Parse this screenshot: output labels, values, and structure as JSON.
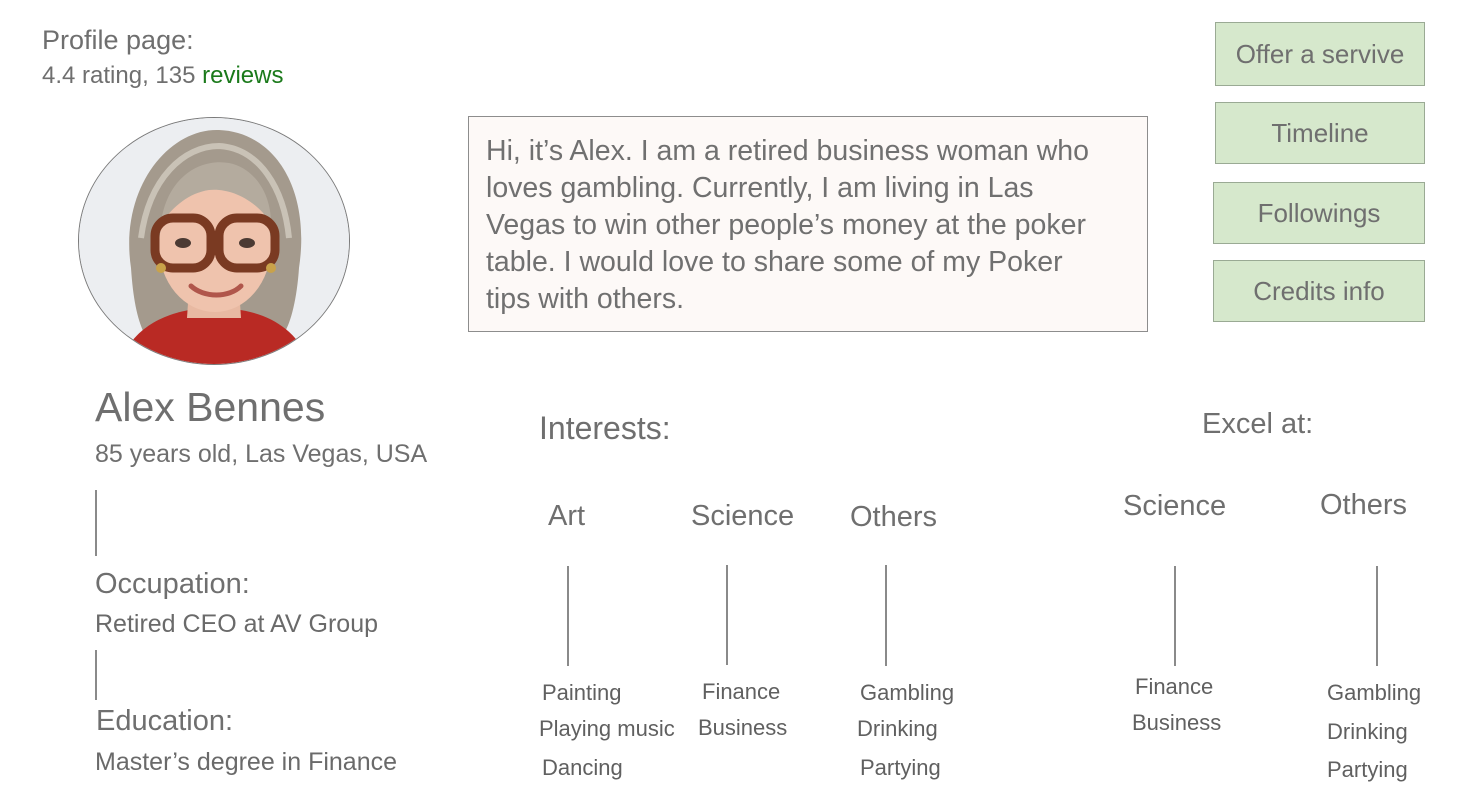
{
  "header": {
    "title": "Profile page:",
    "rating_text": "4.4 rating, 135 ",
    "reviews_link": "reviews"
  },
  "bio": {
    "line1": "Hi, it’s Alex. I am a retired business woman who",
    "line2": "loves gambling. Currently, I am living in Las",
    "line3": "Vegas to win other people’s money at the poker",
    "line4": "table. I would love to share some of my Poker",
    "line5": "tips with others."
  },
  "actions": {
    "offer": "Offer a servive",
    "timeline": "Timeline",
    "followings": "Followings",
    "credits": "Credits info"
  },
  "profile": {
    "name": "Alex Bennes",
    "meta": "85 years old, Las Vegas, USA",
    "occupation_label": "Occupation:",
    "occupation_value": "Retired CEO at AV Group",
    "education_label": "Education:",
    "education_value": "Master’s degree in Finance"
  },
  "interests": {
    "heading": "Interests:",
    "categories": [
      {
        "label": "Art",
        "items": [
          "Painting",
          "Playing music",
          "Dancing"
        ]
      },
      {
        "label": "Science",
        "items": [
          "Finance",
          "Business"
        ]
      },
      {
        "label": "Others",
        "items": [
          "Gambling",
          "Drinking",
          "Partying"
        ]
      }
    ]
  },
  "excel": {
    "heading": "Excel at:",
    "categories": [
      {
        "label": "Science",
        "items": [
          "Finance",
          "Business"
        ]
      },
      {
        "label": "Others",
        "items": [
          "Gambling",
          "Drinking",
          "Partying"
        ]
      }
    ]
  },
  "colors": {
    "button_bg": "#d6e8cc",
    "link_green": "#1b7a1b",
    "text_gray": "#6f6f6f"
  }
}
